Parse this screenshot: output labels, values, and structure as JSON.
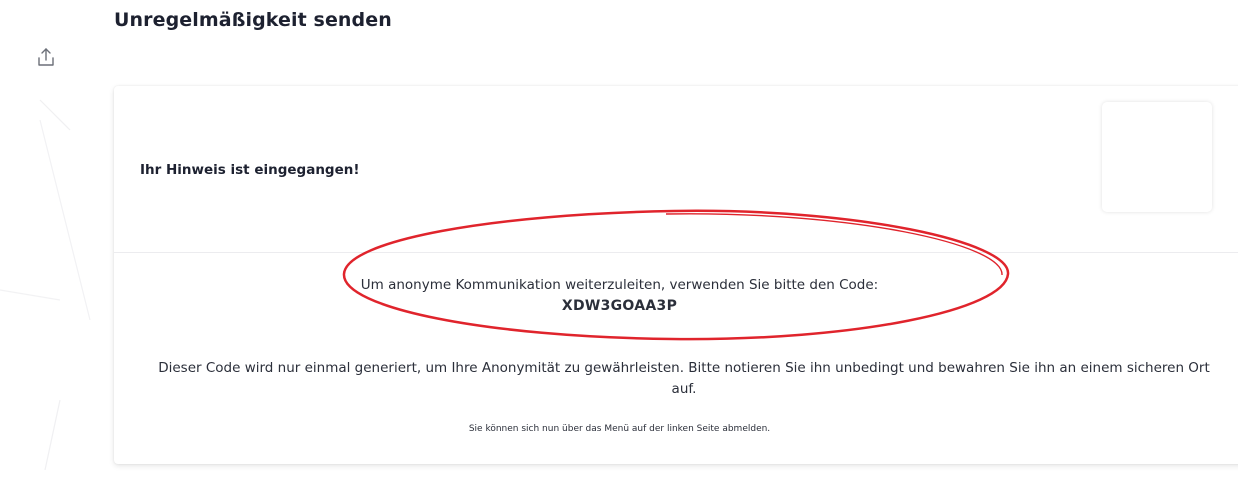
{
  "header": {
    "title": "Unregelmäßigkeit senden"
  },
  "toolbar": {
    "share_icon": "share-upload-icon"
  },
  "card": {
    "confirmation": "Ihr Hinweis ist eingegangen!",
    "code_instruction": "Um anonyme Kommunikation weiterzuleiten, verwenden Sie bitte den Code:",
    "code_value": "XDW3GOAA3P",
    "notice": "Dieser Code wird nur einmal generiert, um Ihre Anonymität zu gewährleisten. Bitte notieren Sie ihn unbedingt und bewahren Sie ihn an einem sicheren Ort auf.",
    "logout_hint": "Sie können sich nun über das Menü auf der linken Seite abmelden."
  },
  "colors": {
    "annotation": "#e0242c",
    "text": "#2b2f3a",
    "card_bg": "#ffffff"
  }
}
